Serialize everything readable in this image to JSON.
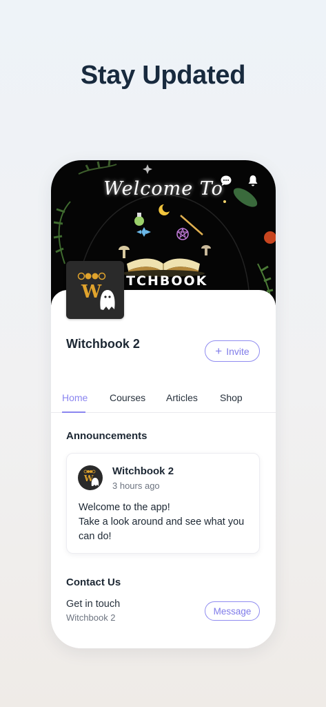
{
  "headline": "Stay Updated",
  "cover": {
    "welcome_text": "Welcome To",
    "title_text": "ITCHBOOK"
  },
  "header_icons": [
    "chat-icon",
    "bell-icon"
  ],
  "group": {
    "name": "Witchbook 2",
    "invite_label": "Invite",
    "invite_icon": "plus-icon"
  },
  "tabs": [
    {
      "label": "Home",
      "active": true
    },
    {
      "label": "Courses",
      "active": false
    },
    {
      "label": "Articles",
      "active": false
    },
    {
      "label": "Shop",
      "active": false
    }
  ],
  "announcements": {
    "title": "Announcements",
    "post": {
      "author": "Witchbook 2",
      "time": "3 hours ago",
      "body_line1": "Welcome to the app!",
      "body_line2": "Take a look around and see what you can do!"
    }
  },
  "contact": {
    "title": "Contact Us",
    "label": "Get in touch",
    "sub": "Witchbook 2",
    "button_label": "Message"
  },
  "colors": {
    "accent": "#8a85f0",
    "text": "#1c2733",
    "cover_bg": "#050505",
    "logo_gold": "#e0a32c"
  }
}
